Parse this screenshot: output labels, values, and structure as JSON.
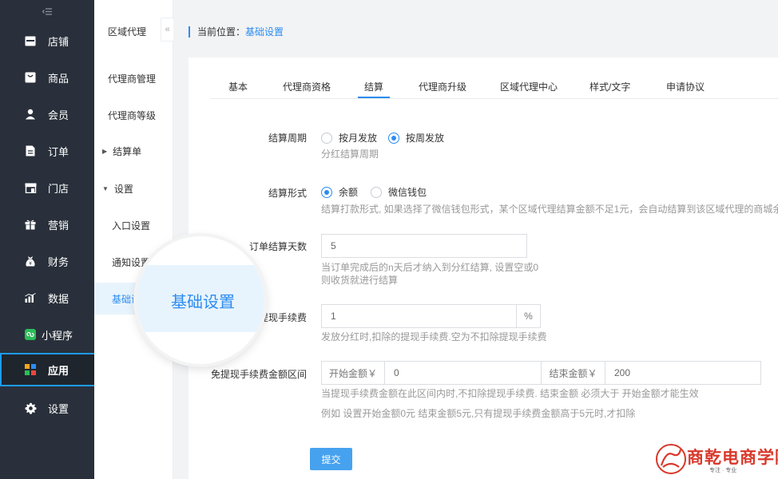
{
  "nav": {
    "toggle_icon": "menu-collapse-icon",
    "items": [
      {
        "label": "店铺",
        "icon": "store-icon"
      },
      {
        "label": "商品",
        "icon": "goods-icon"
      },
      {
        "label": "会员",
        "icon": "user-icon"
      },
      {
        "label": "订单",
        "icon": "order-icon"
      },
      {
        "label": "门店",
        "icon": "shop-icon"
      },
      {
        "label": "营销",
        "icon": "gift-icon"
      },
      {
        "label": "财务",
        "icon": "finance-icon"
      },
      {
        "label": "数据",
        "icon": "chart-icon"
      },
      {
        "label": "小程序",
        "icon": "miniapp-icon"
      },
      {
        "label": "应用",
        "icon": "apps-icon"
      },
      {
        "label": "设置",
        "icon": "gear-icon"
      }
    ],
    "active_index": 9
  },
  "subnav": {
    "title": "区域代理",
    "items": [
      {
        "label": "代理商管理"
      },
      {
        "label": "代理商等级"
      },
      {
        "label": "结算单"
      },
      {
        "label": "设置"
      },
      {
        "label": "入口设置"
      },
      {
        "label": "通知设置"
      },
      {
        "label": "基础设"
      }
    ],
    "collapse": "«"
  },
  "breadcrumb": {
    "prefix": "当前位置：",
    "current": "基础设置"
  },
  "tabs": [
    {
      "label": "基本"
    },
    {
      "label": "代理商资格"
    },
    {
      "label": "结算"
    },
    {
      "label": "代理商升级"
    },
    {
      "label": "区域代理中心"
    },
    {
      "label": "样式/文字"
    },
    {
      "label": "申请协议"
    }
  ],
  "active_tab": 2,
  "form": {
    "cycle": {
      "label": "结算周期",
      "opt_month": "按月发放",
      "opt_week": "按周发放",
      "selected": "按周发放",
      "help": "分红结算周期"
    },
    "mode": {
      "label": "结算形式",
      "opt_balance": "余额",
      "opt_wechat": "微信钱包",
      "selected": "余额",
      "help": "结算打款形式, 如果选择了微信钱包形式，某个区域代理结算金额不足1元，会自动结算到该区域代理的商城余额"
    },
    "days": {
      "label": "订单结算天数",
      "value": "5",
      "help1": "当订单完成后的n天后才纳入到分红结算, 设置空或0",
      "help2": "则收货就进行结算"
    },
    "fee": {
      "label": "提现手续费",
      "value": "1",
      "unit": "%",
      "help": "发放分红时,扣除的提现手续费.空为不扣除提现手续费"
    },
    "range": {
      "label": "免提现手续费金额区间",
      "start_addon": "开始金额￥",
      "start_value": "0",
      "end_addon": "结束金额￥",
      "end_value": "200",
      "help1": "当提现手续费金额在此区间内时,不扣除提现手续费. 结束金额 必须大于 开始金额才能生效",
      "help2": "例如 设置开始金额0元 结束金额5元,只有提现手续费金额高于5元时,才扣除"
    },
    "submit": "提交"
  },
  "magnifier": {
    "text": "基础设置"
  },
  "logo": {
    "text": "商乾电商学院",
    "sub": "专注 · 专业"
  },
  "colors": {
    "accent": "#2d8cf0",
    "nav_bg": "#29303b",
    "logo_red": "#d9382b"
  }
}
